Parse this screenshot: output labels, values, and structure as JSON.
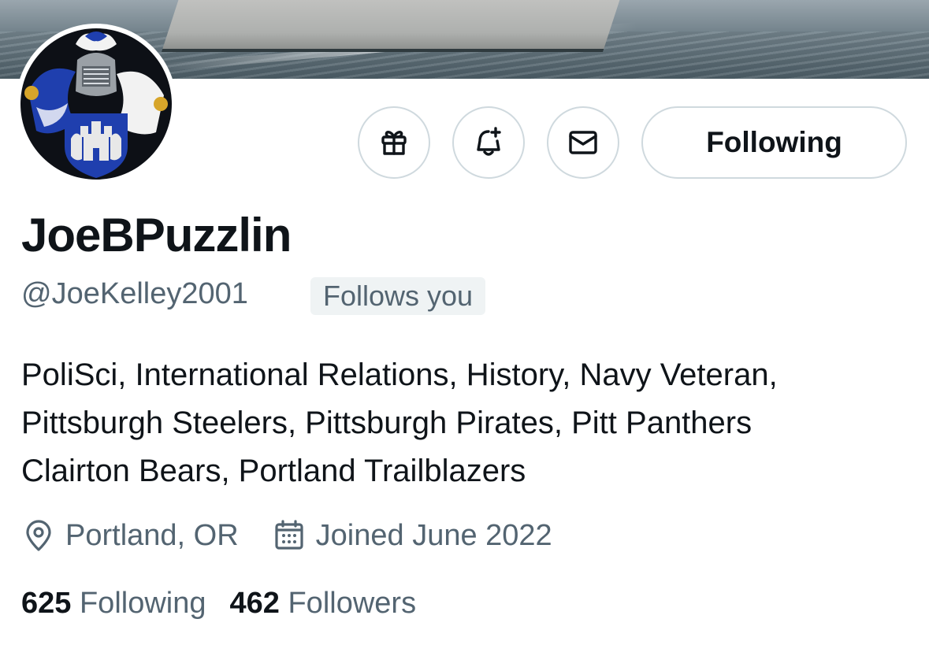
{
  "profile": {
    "display_name": "JoeBPuzzlin",
    "handle": "@JoeKelley2001",
    "follows_you_badge": "Follows you",
    "bio_lines": [
      "PoliSci, International Relations, History, Navy Veteran,",
      "Pittsburgh Steelers, Pittsburgh Pirates, Pitt Panthers",
      "Clairton Bears, Portland Trailblazers"
    ],
    "location": "Portland, OR",
    "joined": "Joined June 2022",
    "following_count": "625",
    "following_label": "Following",
    "followers_count": "462",
    "followers_label": "Followers"
  },
  "actions": {
    "gift_icon": "gift-icon",
    "notify_icon": "bell-plus-icon",
    "message_icon": "envelope-icon",
    "follow_state_label": "Following"
  },
  "colors": {
    "text_primary": "#0f1419",
    "text_secondary": "#536471",
    "border": "#cfd9de",
    "badge_bg": "#eff3f4",
    "crest_blue": "#1f3fae"
  }
}
